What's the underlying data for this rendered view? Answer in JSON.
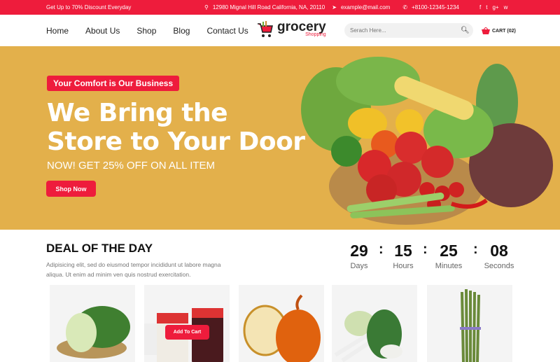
{
  "colors": {
    "accent": "#ee1c3c",
    "hero_bg": "#e3b04b"
  },
  "topbar": {
    "promo": "Get Up to 70% Discount Everyday",
    "address": "12980 Mignal Hill Road California, NA, 20110",
    "email": "example@mail.com",
    "phone": "+8100-12345-1234",
    "social": [
      "f",
      "t",
      "g+",
      "w"
    ]
  },
  "nav": [
    "Home",
    "About Us",
    "Shop",
    "Blog",
    "Contact Us"
  ],
  "logo": {
    "word": "grocery",
    "sub": "Shopping"
  },
  "search": {
    "placeholder": "Serach Here..."
  },
  "cart": {
    "label": "CART (02)"
  },
  "hero": {
    "tag": "Your Comfort is Our Business",
    "title_line1": "We Bring the",
    "title_line2": "Store to Your Door",
    "subtitle": "NOW! GET 25% OFF ON ALL ITEM",
    "button": "Shop Now"
  },
  "deal": {
    "title": "DEAL OF THE DAY",
    "description": "Adipisicing elit, sed do eiusmod tempor incididunt ut labore magna aliqua. Ut enim ad minim ven quis nostrud exercitation.",
    "countdown": [
      {
        "value": "29",
        "label": "Days"
      },
      {
        "value": "15",
        "label": "Hours"
      },
      {
        "value": "25",
        "label": "Minutes"
      },
      {
        "value": "08",
        "label": "Seconds"
      }
    ],
    "add_to_cart": "Add To Cart"
  }
}
